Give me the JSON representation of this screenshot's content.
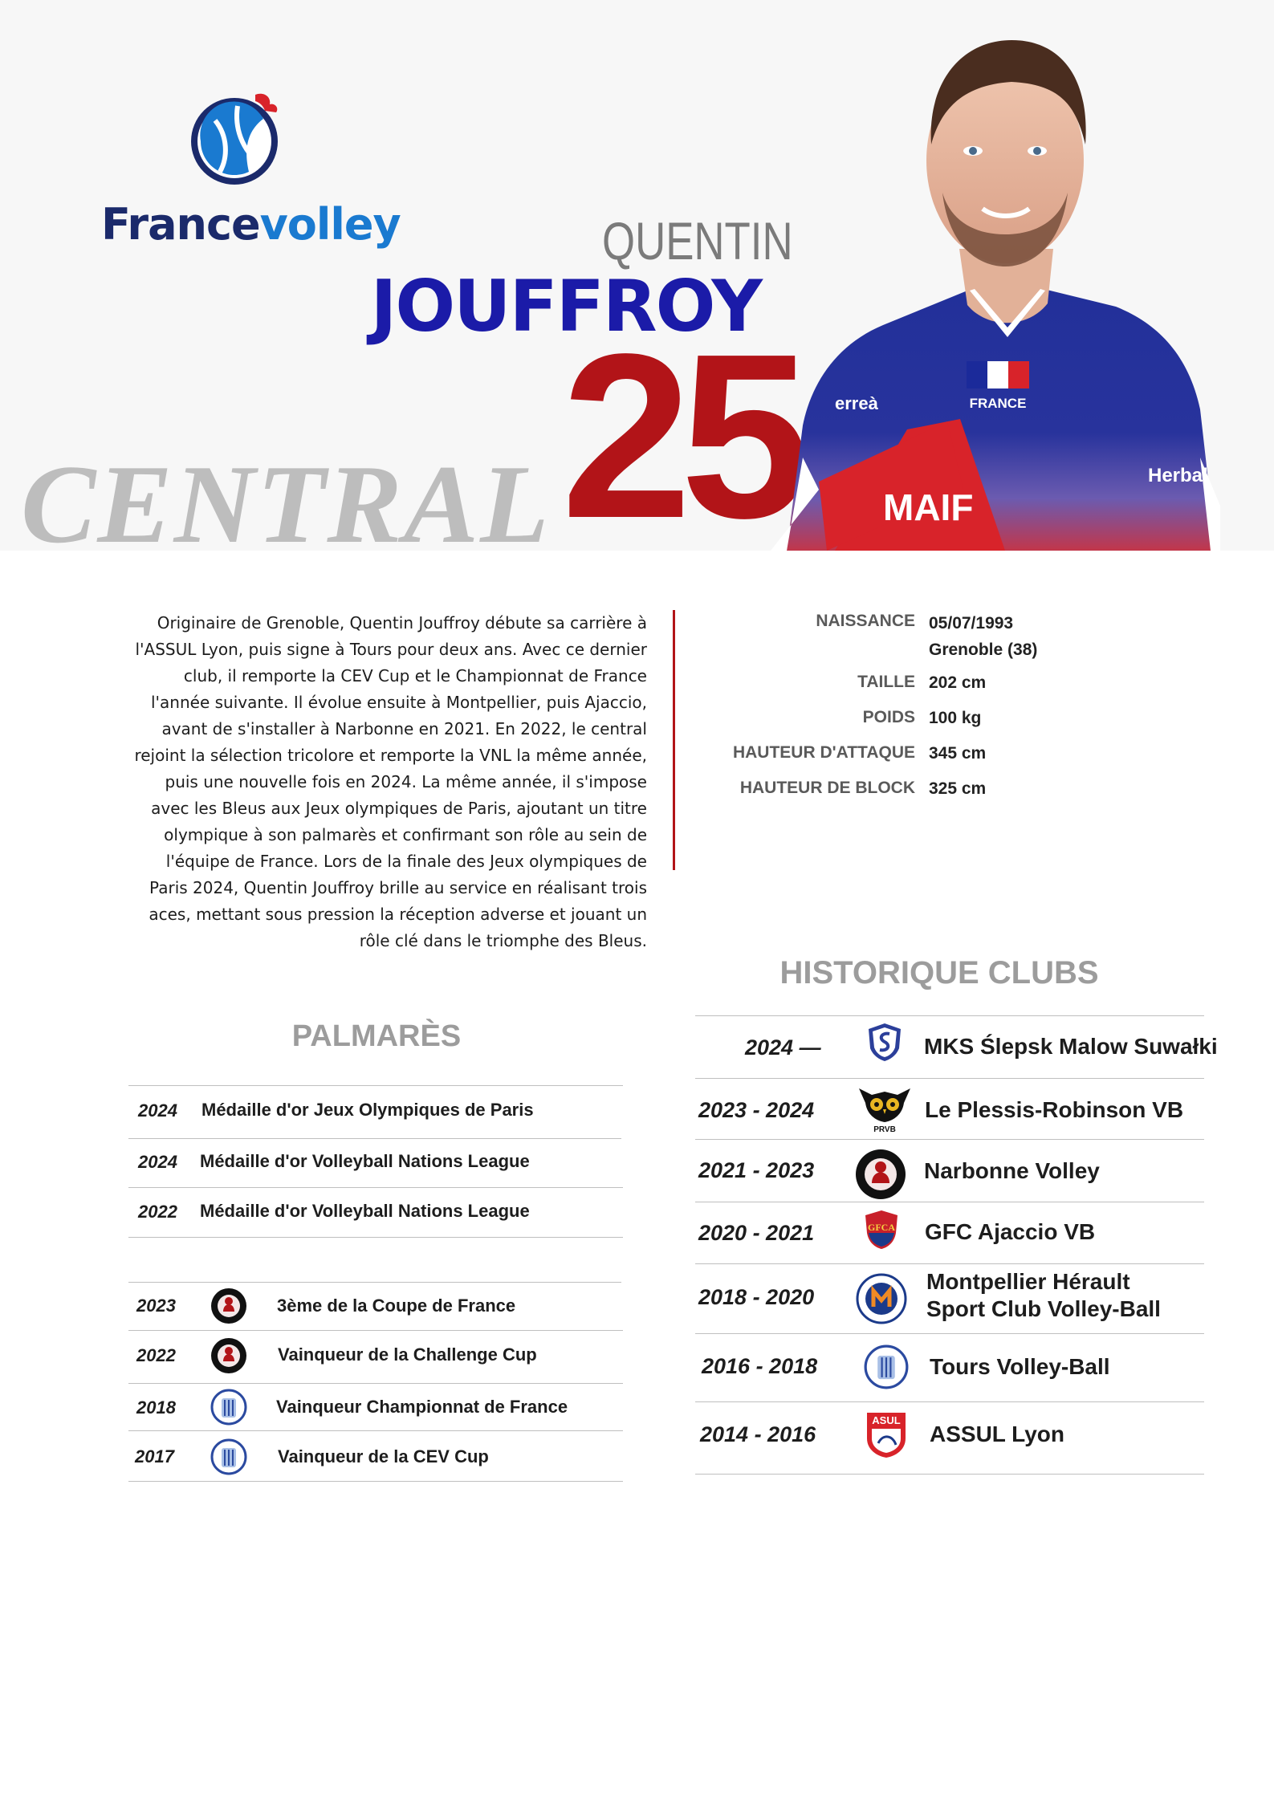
{
  "brand": {
    "part1": "France",
    "part2": "volley"
  },
  "player": {
    "first_name": "QUENTIN",
    "last_name": "JOUFFROY",
    "number": "25",
    "position": "CENTRAL",
    "jersey_text": {
      "country": "FRANCE",
      "sponsor": "MAIF",
      "maker": "erreà",
      "sleeve": "Herbal"
    }
  },
  "bio": "Originaire de Grenoble, Quentin Jouffroy débute sa carrière à l'ASSUL Lyon, puis signe à Tours pour deux ans. Avec ce dernier club, il remporte la CEV Cup et le Championnat de France l'année suivante. Il évolue ensuite à Montpellier, puis Ajaccio, avant de s'installer à Narbonne en 2021. En 2022, le central rejoint la sélection tricolore et remporte la VNL la même année, puis une nouvelle fois en 2024. La même année, il s'impose avec les Bleus aux Jeux olympiques de Paris, ajoutant un titre olympique à son palmarès et confirmant son rôle au sein de l'équipe de France. Lors de la finale des Jeux olympiques de Paris 2024, Quentin Jouffroy brille au service en réalisant trois aces, mettant sous pression la réception adverse et jouant un rôle clé dans le triomphe des Bleus.",
  "info": [
    {
      "label": "NAISSANCE",
      "value": "05/07/1993",
      "value2": "Grenoble (38)"
    },
    {
      "label": "TAILLE",
      "value": "202 cm"
    },
    {
      "label": "POIDS",
      "value": "100 kg"
    },
    {
      "label": "HAUTEUR D'ATTAQUE",
      "value": "345 cm"
    },
    {
      "label": "HAUTEUR DE BLOCK",
      "value": "325 cm"
    }
  ],
  "palmares": {
    "title": "PALMARÈS",
    "national": [
      {
        "year": "2024",
        "text": "Médaille d'or Jeux Olympiques de Paris"
      },
      {
        "year": "2024",
        "text": "Médaille d'or Volleyball Nations League"
      },
      {
        "year": "2022",
        "text": "Médaille d'or Volleyball Nations League"
      }
    ],
    "clubs": [
      {
        "year": "2023",
        "logo": "narbonne-logo",
        "text": "3ème de la Coupe de France"
      },
      {
        "year": "2022",
        "logo": "narbonne-logo",
        "text": "Vainqueur de la Challenge Cup"
      },
      {
        "year": "2018",
        "logo": "tours-logo",
        "text": "Vainqueur Championnat de France"
      },
      {
        "year": "2017",
        "logo": "tours-logo",
        "text": "Vainqueur de la CEV Cup"
      }
    ]
  },
  "history": {
    "title": "HISTORIQUE CLUBS",
    "items": [
      {
        "years": "2024 —",
        "logo": "suwalki-logo",
        "name": "MKS Ślepsk Malow Suwałki",
        "name2": ""
      },
      {
        "years": "2023 - 2024",
        "logo": "prvb-owl-logo",
        "name": "Le Plessis-Robinson VB",
        "name2": ""
      },
      {
        "years": "2021 - 2023",
        "logo": "narbonne-logo",
        "name": "Narbonne Volley",
        "name2": ""
      },
      {
        "years": "2020 - 2021",
        "logo": "gfca-logo",
        "name": "GFC Ajaccio VB",
        "name2": ""
      },
      {
        "years": "2018 - 2020",
        "logo": "montpellier-logo",
        "name": "Montpellier Hérault",
        "name2": "Sport Club Volley-Ball"
      },
      {
        "years": "2016 - 2018",
        "logo": "tours-logo",
        "name": "Tours Volley-Ball",
        "name2": ""
      },
      {
        "years": "2014 - 2016",
        "logo": "assul-logo",
        "name": "ASSUL Lyon",
        "name2": ""
      }
    ]
  },
  "colors": {
    "navy": "#1b1ba8",
    "red": "#b21418",
    "grey": "#9c9c9c",
    "brand_dark": "#1b2a6b",
    "brand_light": "#1a7ad0"
  }
}
